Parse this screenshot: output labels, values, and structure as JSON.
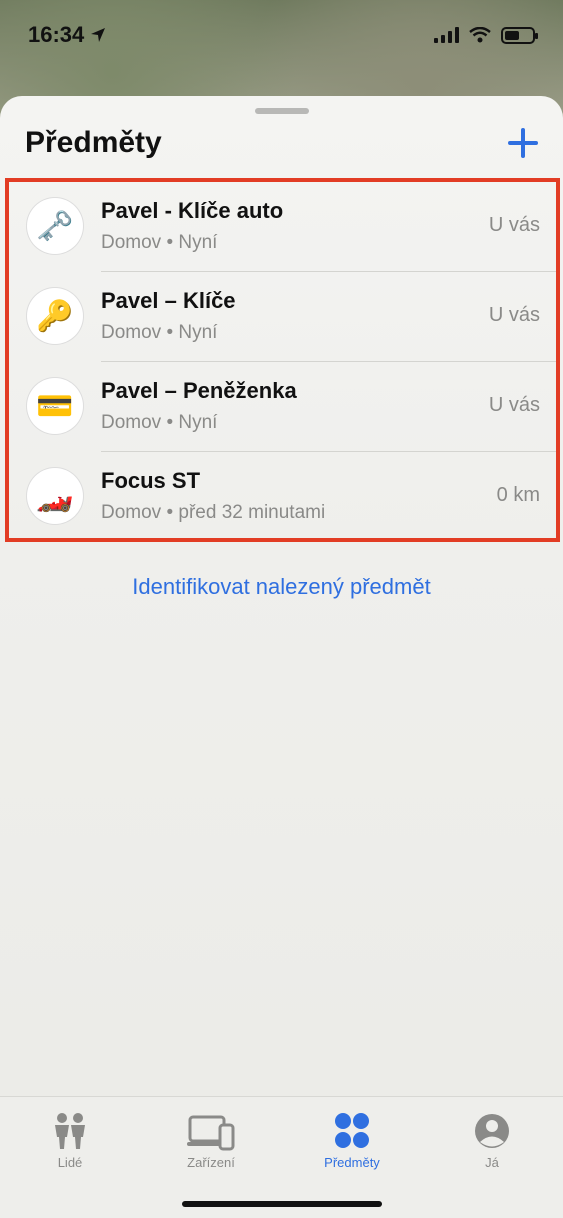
{
  "status_bar": {
    "time": "16:34"
  },
  "sheet": {
    "title": "Předměty"
  },
  "items": [
    {
      "name": "Pavel - Klíče auto",
      "subtitle": "Domov • Nyní",
      "status": "U vás",
      "icon": "🗝️",
      "icon_name": "old-key-icon"
    },
    {
      "name": "Pavel – Klíče",
      "subtitle": "Domov • Nyní",
      "status": "U vás",
      "icon": "🔑",
      "icon_name": "key-icon"
    },
    {
      "name": "Pavel – Peněženka",
      "subtitle": "Domov • Nyní",
      "status": "U vás",
      "icon": "💳",
      "icon_name": "credit-card-icon"
    },
    {
      "name": "Focus ST",
      "subtitle": "Domov • před 32 minutami",
      "status": "0 km",
      "icon": "🏎️",
      "icon_name": "race-car-icon"
    }
  ],
  "identify_link": "Identifikovat nalezený předmět",
  "tabs": [
    {
      "label": "Lidé"
    },
    {
      "label": "Zařízení"
    },
    {
      "label": "Předměty"
    },
    {
      "label": "Já"
    }
  ],
  "colors": {
    "accent": "#2f6fe0",
    "highlight_border": "#e23c24"
  }
}
